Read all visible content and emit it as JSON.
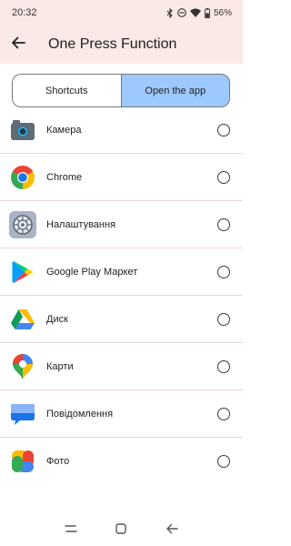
{
  "status_bar": {
    "time": "20:32",
    "battery": "56%"
  },
  "app_bar": {
    "title": "One Press Function"
  },
  "segments": {
    "shortcuts": "Shortcuts",
    "open_app": "Open the app"
  },
  "apps": [
    {
      "label": "Камера",
      "icon": "camera-icon"
    },
    {
      "label": "Chrome",
      "icon": "chrome-icon"
    },
    {
      "label": "Налаштування",
      "icon": "settings-icon"
    },
    {
      "label": "Google Play Маркет",
      "icon": "play-store-icon"
    },
    {
      "label": "Диск",
      "icon": "drive-icon"
    },
    {
      "label": "Карти",
      "icon": "maps-icon"
    },
    {
      "label": "Повідомлення",
      "icon": "messages-icon"
    },
    {
      "label": "Фото",
      "icon": "photos-icon"
    }
  ],
  "colors": {
    "header_bg": "#fbe9e7",
    "selected_segment": "#9ec9ff",
    "divider": "#ecd6d8"
  }
}
